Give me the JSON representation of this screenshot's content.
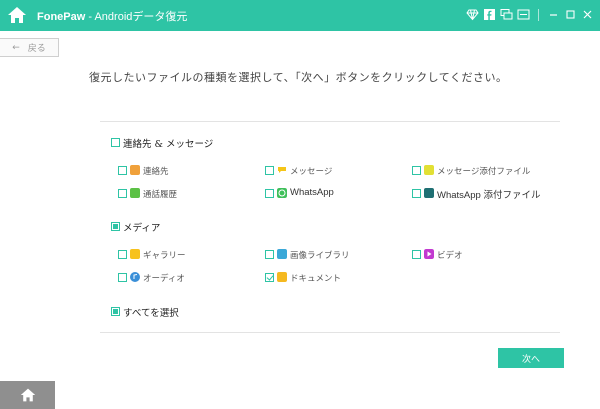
{
  "app": {
    "brand": "FonePaw",
    "title_suffix": " - Androidデータ復元"
  },
  "toolbar": {
    "back_label": "戻る",
    "icons": [
      "diamond-icon",
      "facebook-icon",
      "chat-icon",
      "feedback-icon",
      "minimize-icon",
      "maximize-icon",
      "close-icon"
    ]
  },
  "instruction": "復元したいファイルの種類を選択して、「次へ」ボタンをクリックしてください。",
  "sections": {
    "contacts": {
      "label": "連絡先 & メッセージ",
      "items": [
        {
          "label": "連絡先",
          "icon": "contacts-icon",
          "color": "#f0a13b"
        },
        {
          "label": "メッセージ",
          "icon": "message-icon",
          "color": "#f5c518"
        },
        {
          "label": "メッセージ添付ファイル",
          "icon": "message-attachment-icon",
          "color": "#e2e034"
        },
        {
          "label": "通話履歴",
          "icon": "call-log-icon",
          "color": "#5cc146"
        },
        {
          "label": "WhatsApp",
          "icon": "whatsapp-icon",
          "color": "#3fbf5a"
        },
        {
          "label": "WhatsApp 添付ファイル",
          "icon": "whatsapp-attachment-icon",
          "color": "#1f6f73"
        }
      ]
    },
    "media": {
      "label": "メディア",
      "items": [
        {
          "label": "ギャラリー",
          "icon": "gallery-icon",
          "color": "#f7c21d"
        },
        {
          "label": "画像ライブラリ",
          "icon": "picture-library-icon",
          "color": "#3aa8d8"
        },
        {
          "label": "ビデオ",
          "icon": "video-icon",
          "color": "#c23ad0"
        },
        {
          "label": "オーディオ",
          "icon": "audio-icon",
          "color": "#3a8fd8"
        },
        {
          "label": "ドキュメント",
          "icon": "document-icon",
          "color": "#f5b920"
        }
      ]
    },
    "select_all": {
      "label": "すべてを選択"
    }
  },
  "next_button": "次へ",
  "colors": {
    "accent": "#2ec4a5",
    "bottom_bar": "#8f8f8f"
  }
}
